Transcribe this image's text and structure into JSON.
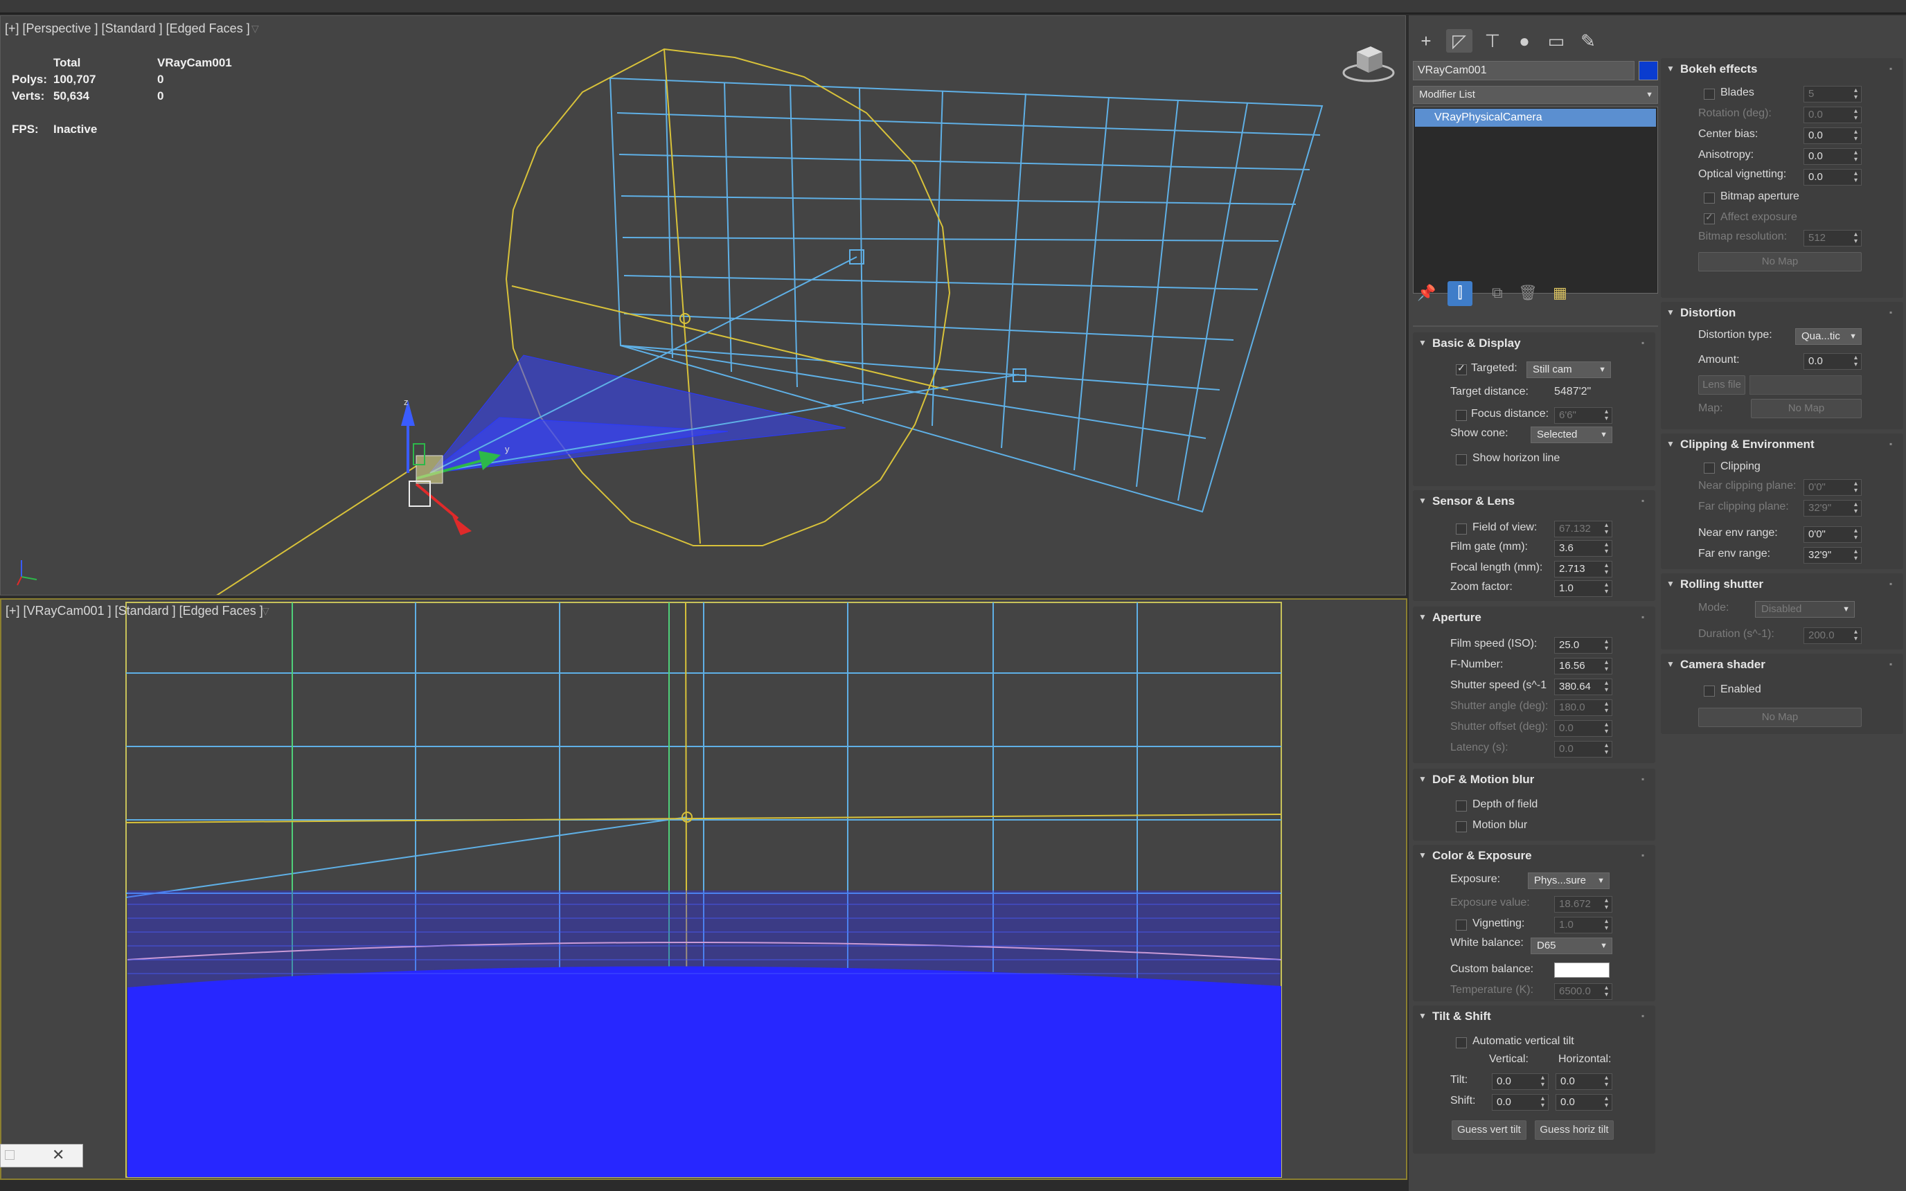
{
  "viewport_top": {
    "label": "[+] [Perspective ] [Standard ] [Edged Faces ]",
    "stats": {
      "total_header": "Total",
      "object_header": "VRayCam001",
      "polys_label": "Polys:",
      "polys_total": "100,707",
      "polys_obj": "0",
      "verts_label": "Verts:",
      "verts_total": "50,634",
      "verts_obj": "0",
      "fps_label": "FPS:",
      "fps_value": "Inactive"
    },
    "gizmo_z": "z",
    "gizmo_y": "y"
  },
  "viewport_bottom": {
    "label": "[+] [VRayCam001 ] [Standard ] [Edged Faces ]"
  },
  "command_panel": {
    "object_name": "VRayCam001",
    "object_color": "#0a3ccf",
    "modifier_list": "Modifier List",
    "stack": [
      "VRayPhysicalCamera"
    ],
    "basic_display": {
      "title": "Basic & Display",
      "targeted_label": "Targeted:",
      "targeted_checked": true,
      "type_value": "Still cam",
      "target_distance_label": "Target distance:",
      "target_distance_value": "5487'2\"",
      "focus_distance_label": "Focus distance:",
      "focus_distance_value": "6'6\"",
      "show_cone_label": "Show cone:",
      "show_cone_value": "Selected",
      "horizon_label": "Show horizon line"
    },
    "sensor_lens": {
      "title": "Sensor & Lens",
      "fov_label": "Field of view:",
      "fov_value": "67.132",
      "film_gate_label": "Film gate (mm):",
      "film_gate_value": "3.6",
      "focal_label": "Focal length (mm):",
      "focal_value": "2.713",
      "zoom_label": "Zoom factor:",
      "zoom_value": "1.0"
    },
    "aperture": {
      "title": "Aperture",
      "iso_label": "Film speed (ISO):",
      "iso_value": "25.0",
      "fnum_label": "F-Number:",
      "fnum_value": "16.56",
      "shutter_label": "Shutter speed (s^-1",
      "shutter_value": "380.64",
      "angle_label": "Shutter angle (deg):",
      "angle_value": "180.0",
      "offset_label": "Shutter offset (deg):",
      "offset_value": "0.0",
      "latency_label": "Latency (s):",
      "latency_value": "0.0"
    },
    "dof": {
      "title": "DoF & Motion blur",
      "dof_label": "Depth of field",
      "mblur_label": "Motion blur"
    },
    "color_exposure": {
      "title": "Color & Exposure",
      "exposure_label": "Exposure:",
      "exposure_value": "Phys...sure",
      "ev_label": "Exposure value:",
      "ev_value": "18.672",
      "vignetting_label": "Vignetting:",
      "vignetting_value": "1.0",
      "wb_label": "White balance:",
      "wb_value": "D65",
      "custom_label": "Custom balance:",
      "custom_color": "#ffffff",
      "temp_label": "Temperature (K):",
      "temp_value": "6500.0"
    },
    "tilt_shift": {
      "title": "Tilt & Shift",
      "auto_label": "Automatic vertical tilt",
      "vertical_label": "Vertical:",
      "horizontal_label": "Horizontal:",
      "tilt_label": "Tilt:",
      "tilt_v": "0.0",
      "tilt_h": "0.0",
      "shift_label": "Shift:",
      "shift_v": "0.0",
      "shift_h": "0.0",
      "guess_vert": "Guess vert tilt",
      "guess_horiz": "Guess horiz tilt"
    },
    "bokeh": {
      "title": "Bokeh effects",
      "blades_label": "Blades",
      "blades_value": "5",
      "rotation_label": "Rotation (deg):",
      "rotation_value": "0.0",
      "center_label": "Center bias:",
      "center_value": "0.0",
      "aniso_label": "Anisotropy:",
      "aniso_value": "0.0",
      "optical_label": "Optical vignetting:",
      "optical_value": "0.0",
      "bitmap_ap_label": "Bitmap aperture",
      "affect_label": "Affect exposure",
      "bitmap_res_label": "Bitmap resolution:",
      "bitmap_res_value": "512",
      "no_map": "No Map"
    },
    "distortion": {
      "title": "Distortion",
      "type_label": "Distortion type:",
      "type_value": "Qua...tic",
      "amount_label": "Amount:",
      "amount_value": "0.0",
      "lens_file_label": "Lens file",
      "map_label": "Map:",
      "no_map": "No Map"
    },
    "clipping": {
      "title": "Clipping & Environment",
      "clipping_label": "Clipping",
      "near_clip_label": "Near clipping plane:",
      "near_clip_value": "0'0\"",
      "far_clip_label": "Far clipping plane:",
      "far_clip_value": "32'9\"",
      "near_env_label": "Near env range:",
      "near_env_value": "0'0\"",
      "far_env_label": "Far env range:",
      "far_env_value": "32'9\""
    },
    "rolling": {
      "title": "Rolling shutter",
      "mode_label": "Mode:",
      "mode_value": "Disabled",
      "duration_label": "Duration (s^-1):",
      "duration_value": "200.0"
    },
    "camera_shader": {
      "title": "Camera shader",
      "enabled_label": "Enabled",
      "no_map": "No Map"
    }
  }
}
